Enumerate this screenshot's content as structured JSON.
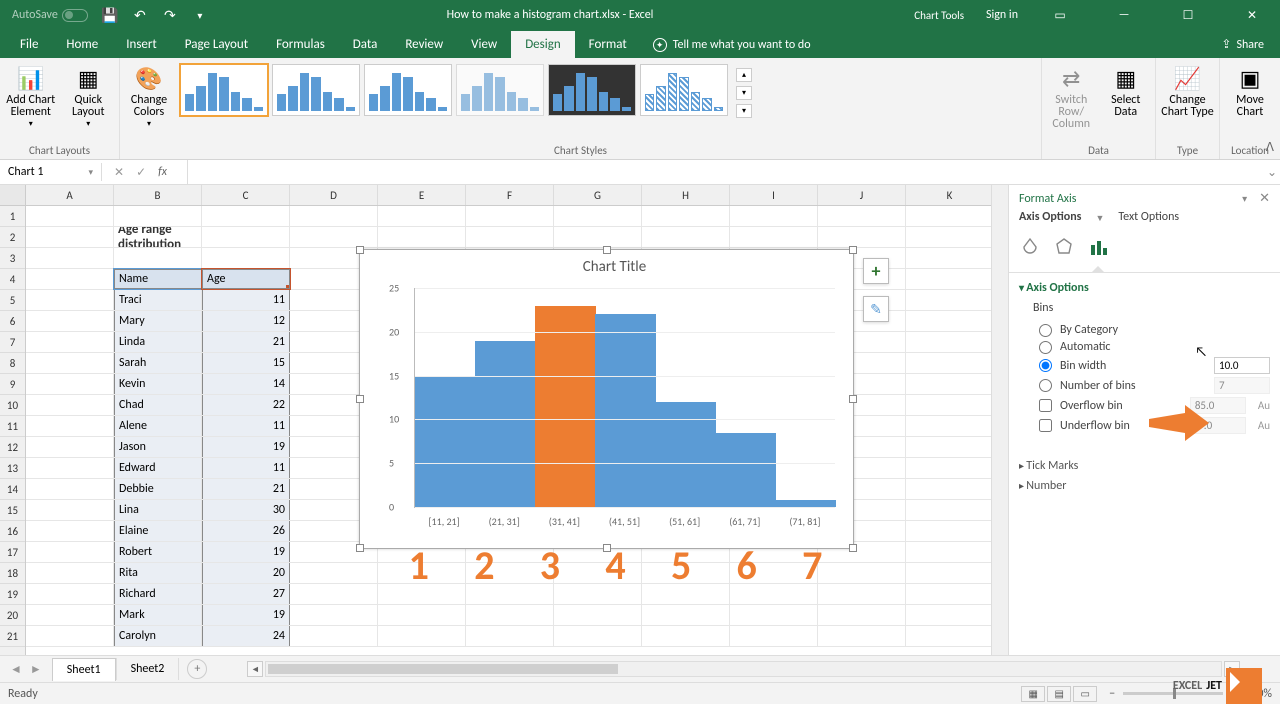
{
  "titlebar": {
    "autosave": "AutoSave",
    "filename": "How to make a histogram chart.xlsx - Excel",
    "charttools": "Chart Tools",
    "signin": "Sign in"
  },
  "tabs": {
    "file": "File",
    "home": "Home",
    "insert": "Insert",
    "pagelayout": "Page Layout",
    "formulas": "Formulas",
    "data": "Data",
    "review": "Review",
    "view": "View",
    "design": "Design",
    "format": "Format",
    "tellme": "Tell me what you want to do",
    "share": "Share"
  },
  "ribbon": {
    "layouts": "Chart Layouts",
    "add_element": "Add Chart Element",
    "quick_layout": "Quick Layout",
    "styles": "Chart Styles",
    "change_colors": "Change Colors",
    "data": "Data",
    "switch": "Switch Row/\nColumn",
    "select": "Select Data",
    "type": "Type",
    "change_type": "Change Chart Type",
    "location": "Location",
    "move": "Move Chart"
  },
  "namebox": "Chart 1",
  "fx": "fx",
  "sheet": {
    "title": "Age range distribution",
    "headers": {
      "a": "Name",
      "b": "Age"
    },
    "cols": [
      "A",
      "B",
      "C",
      "D",
      "E",
      "F",
      "G",
      "H",
      "I",
      "J",
      "K"
    ],
    "rows": [
      {
        "a": "Traci",
        "b": 11
      },
      {
        "a": "Mary",
        "b": 12
      },
      {
        "a": "Linda",
        "b": 21
      },
      {
        "a": "Sarah",
        "b": 15
      },
      {
        "a": "Kevin",
        "b": 14
      },
      {
        "a": "Chad",
        "b": 22
      },
      {
        "a": "Alene",
        "b": 11
      },
      {
        "a": "Jason",
        "b": 19
      },
      {
        "a": "Edward",
        "b": 11
      },
      {
        "a": "Debbie",
        "b": 21
      },
      {
        "a": "Lina",
        "b": 30
      },
      {
        "a": "Elaine",
        "b": 26
      },
      {
        "a": "Robert",
        "b": 19
      },
      {
        "a": "Rita",
        "b": 20
      },
      {
        "a": "Richard",
        "b": 27
      },
      {
        "a": "Mark",
        "b": 19
      },
      {
        "a": "Carolyn",
        "b": 24
      }
    ]
  },
  "chart_data": {
    "type": "bar",
    "title": "Chart Title",
    "categories": [
      "[11, 21]",
      "(21, 31]",
      "(31, 41]",
      "(41, 51]",
      "(51, 61]",
      "(61, 71]",
      "(71, 81]"
    ],
    "values": [
      15,
      19,
      23,
      22,
      12,
      8.5,
      0.8
    ],
    "ylim": [
      0,
      25
    ],
    "yticks": [
      0,
      5,
      10,
      15,
      20,
      25
    ],
    "highlight_index": 2,
    "bin_numbers": [
      "1",
      "2",
      "3",
      "4",
      "5",
      "6",
      "7"
    ]
  },
  "pane": {
    "title": "Format Axis",
    "axis_options_tab": "Axis Options",
    "text_options_tab": "Text Options",
    "axis_options": "Axis Options",
    "bins": "Bins",
    "by_category": "By Category",
    "automatic": "Automatic",
    "bin_width": "Bin width",
    "bin_width_val": "10.0",
    "num_bins": "Number of bins",
    "num_bins_val": "7",
    "overflow": "Overflow bin",
    "overflow_val": "85.0",
    "underflow": "Underflow bin",
    "underflow_val": "-7.0",
    "auto": "Au",
    "tick_marks": "Tick Marks",
    "number": "Number"
  },
  "sheettabs": {
    "s1": "Sheet1",
    "s2": "Sheet2"
  },
  "status": {
    "ready": "Ready",
    "zoom": "100%"
  },
  "watermark": {
    "a": "EXCEL",
    "b": "JET"
  }
}
